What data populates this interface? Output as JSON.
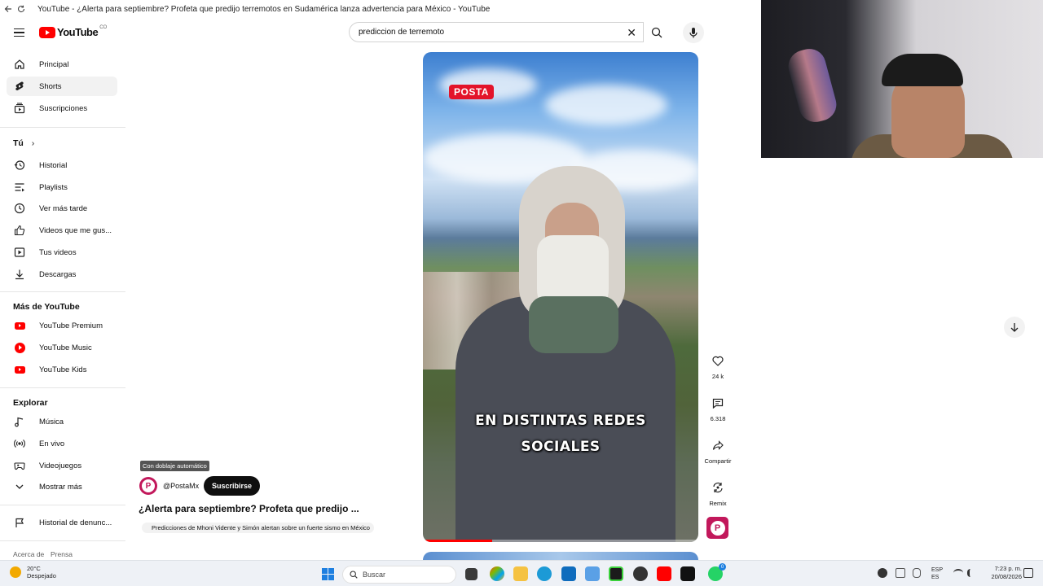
{
  "browser": {
    "window_title": "YouTube - ¿Alerta para septiembre? Profeta que predijo terremotos en Sudamérica lanza advertencia para México - YouTube"
  },
  "masthead": {
    "logo_text": "YouTube",
    "country_code": "CO",
    "search_value": "prediccion de terremoto"
  },
  "sidebar": {
    "main_items": [
      {
        "label": "Principal",
        "icon": "home-icon"
      },
      {
        "label": "Shorts",
        "icon": "shorts-icon"
      },
      {
        "label": "Suscripciones",
        "icon": "subscriptions-icon"
      }
    ],
    "you_heading": "Tú",
    "you_items": [
      {
        "label": "Historial",
        "icon": "history-icon"
      },
      {
        "label": "Playlists",
        "icon": "playlists-icon"
      },
      {
        "label": "Ver más tarde",
        "icon": "watch-later-icon"
      },
      {
        "label": "Videos que me gus...",
        "icon": "thumbs-up-icon"
      },
      {
        "label": "Tus videos",
        "icon": "your-videos-icon"
      },
      {
        "label": "Descargas",
        "icon": "download-icon"
      }
    ],
    "more_heading": "Más de YouTube",
    "more_items": [
      {
        "label": "YouTube Premium",
        "icon": "youtube-premium-icon"
      },
      {
        "label": "YouTube Music",
        "icon": "youtube-music-icon"
      },
      {
        "label": "YouTube Kids",
        "icon": "youtube-kids-icon"
      }
    ],
    "explore_heading": "Explorar",
    "explore_items": [
      {
        "label": "Música",
        "icon": "music-note-icon"
      },
      {
        "label": "En vivo",
        "icon": "live-icon"
      },
      {
        "label": "Videojuegos",
        "icon": "gaming-icon"
      },
      {
        "label": "Mostrar más",
        "icon": "chevron-down-icon"
      }
    ],
    "report_item": {
      "label": "Historial de denunc...",
      "icon": "flag-icon"
    },
    "footer_links": [
      "Acerca de",
      "Prensa"
    ]
  },
  "short": {
    "badge": "POSTA",
    "caption_line1": "EN DISTINTAS REDES",
    "caption_line2": "SOCIALES",
    "progress_fraction": 0.25,
    "dub_label": "Con doblaje automático",
    "channel_handle": "@PostaMx",
    "avatar_letter": "P",
    "subscribe_label": "Suscribirse",
    "title": "¿Alerta para septiembre? Profeta que predijo ...",
    "suggested": "Predicciones de Mhoni Vidente y Simón alertan sobre un fuerte sismo en México"
  },
  "actions": {
    "likes": "24 k",
    "comments": "6.318",
    "share": "Compartir",
    "remix": "Remix"
  },
  "taskbar": {
    "temperature": "20°C",
    "weather": "Despejado",
    "search_placeholder": "Buscar",
    "lang_line1": "ESP",
    "lang_line2": "ES",
    "time": "7:23 p. m.",
    "date": "20/08/2026",
    "notification_count": "0"
  },
  "colors": {
    "brand_red": "#ff0000",
    "posta_red": "#e3142a",
    "posta_magenta": "#c2185b"
  }
}
